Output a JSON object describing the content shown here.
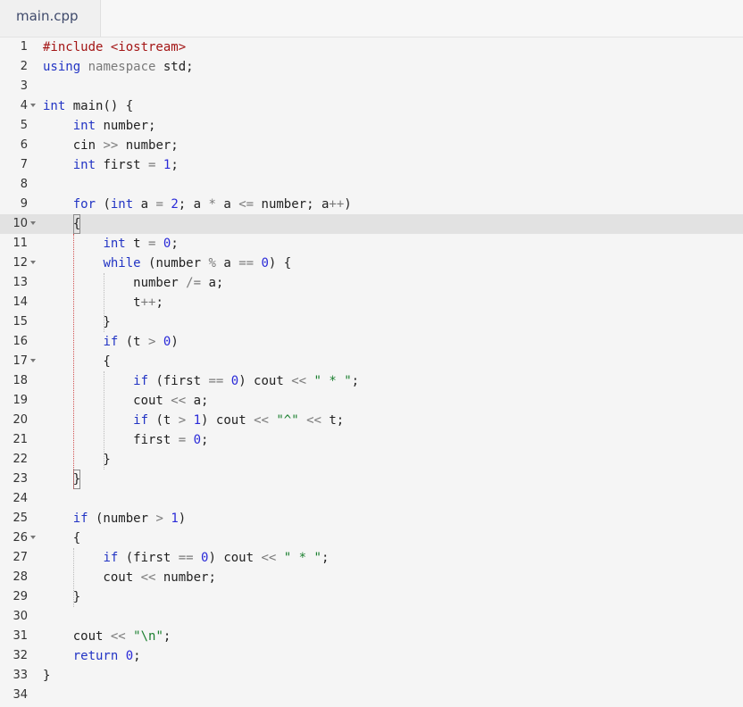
{
  "tab": {
    "label": "main.cpp"
  },
  "editor": {
    "active_line": 10,
    "lines": [
      {
        "n": "1",
        "fold": false,
        "tokens": [
          [
            "kw-str",
            "#include "
          ],
          [
            "str",
            "<iostream>"
          ]
        ]
      },
      {
        "n": "2",
        "fold": false,
        "tokens": [
          [
            "kw",
            "using"
          ],
          [
            "p",
            " "
          ],
          [
            "ns",
            "namespace"
          ],
          [
            "p",
            " std;"
          ]
        ]
      },
      {
        "n": "3",
        "fold": false,
        "tokens": []
      },
      {
        "n": "4",
        "fold": true,
        "tokens": [
          [
            "kw",
            "int"
          ],
          [
            "p",
            " main() {"
          ]
        ]
      },
      {
        "n": "5",
        "fold": false,
        "tokens": [
          [
            "p",
            "    "
          ],
          [
            "kw",
            "int"
          ],
          [
            "p",
            " number;"
          ]
        ]
      },
      {
        "n": "6",
        "fold": false,
        "tokens": [
          [
            "p",
            "    cin "
          ],
          [
            "op",
            ">>"
          ],
          [
            "p",
            " number;"
          ]
        ]
      },
      {
        "n": "7",
        "fold": false,
        "tokens": [
          [
            "p",
            "    "
          ],
          [
            "kw",
            "int"
          ],
          [
            "p",
            " first "
          ],
          [
            "op",
            "="
          ],
          [
            "p",
            " "
          ],
          [
            "num",
            "1"
          ],
          [
            "p",
            ";"
          ]
        ]
      },
      {
        "n": "8",
        "fold": false,
        "tokens": []
      },
      {
        "n": "9",
        "fold": false,
        "tokens": [
          [
            "p",
            "    "
          ],
          [
            "kw",
            "for"
          ],
          [
            "p",
            " ("
          ],
          [
            "kw",
            "int"
          ],
          [
            "p",
            " a "
          ],
          [
            "op",
            "="
          ],
          [
            "p",
            " "
          ],
          [
            "num",
            "2"
          ],
          [
            "p",
            "; a "
          ],
          [
            "op",
            "*"
          ],
          [
            "p",
            " a "
          ],
          [
            "op",
            "<="
          ],
          [
            "p",
            " number; a"
          ],
          [
            "op",
            "++"
          ],
          [
            "p",
            ")"
          ]
        ]
      },
      {
        "n": "10",
        "fold": true,
        "tokens": [
          [
            "p",
            "    "
          ],
          [
            "box",
            "{"
          ]
        ]
      },
      {
        "n": "11",
        "fold": false,
        "tokens": [
          [
            "p",
            "        "
          ],
          [
            "kw",
            "int"
          ],
          [
            "p",
            " t "
          ],
          [
            "op",
            "="
          ],
          [
            "p",
            " "
          ],
          [
            "num",
            "0"
          ],
          [
            "p",
            ";"
          ]
        ]
      },
      {
        "n": "12",
        "fold": true,
        "tokens": [
          [
            "p",
            "        "
          ],
          [
            "kw",
            "while"
          ],
          [
            "p",
            " (number "
          ],
          [
            "op",
            "%"
          ],
          [
            "p",
            " a "
          ],
          [
            "op",
            "=="
          ],
          [
            "p",
            " "
          ],
          [
            "num",
            "0"
          ],
          [
            "p",
            ") {"
          ]
        ]
      },
      {
        "n": "13",
        "fold": false,
        "tokens": [
          [
            "p",
            "            number "
          ],
          [
            "op",
            "/="
          ],
          [
            "p",
            " a;"
          ]
        ]
      },
      {
        "n": "14",
        "fold": false,
        "tokens": [
          [
            "p",
            "            t"
          ],
          [
            "op",
            "++"
          ],
          [
            "p",
            ";"
          ]
        ]
      },
      {
        "n": "15",
        "fold": false,
        "tokens": [
          [
            "p",
            "        }"
          ]
        ]
      },
      {
        "n": "16",
        "fold": false,
        "tokens": [
          [
            "p",
            "        "
          ],
          [
            "kw",
            "if"
          ],
          [
            "p",
            " (t "
          ],
          [
            "op",
            ">"
          ],
          [
            "p",
            " "
          ],
          [
            "num",
            "0"
          ],
          [
            "p",
            ")"
          ]
        ]
      },
      {
        "n": "17",
        "fold": true,
        "tokens": [
          [
            "p",
            "        {"
          ]
        ]
      },
      {
        "n": "18",
        "fold": false,
        "tokens": [
          [
            "p",
            "            "
          ],
          [
            "kw",
            "if"
          ],
          [
            "p",
            " (first "
          ],
          [
            "op",
            "=="
          ],
          [
            "p",
            " "
          ],
          [
            "num",
            "0"
          ],
          [
            "p",
            ") cout "
          ],
          [
            "op",
            "<<"
          ],
          [
            "p",
            " "
          ],
          [
            "strg",
            "\" * \""
          ],
          [
            "p",
            ";"
          ]
        ]
      },
      {
        "n": "19",
        "fold": false,
        "tokens": [
          [
            "p",
            "            cout "
          ],
          [
            "op",
            "<<"
          ],
          [
            "p",
            " a;"
          ]
        ]
      },
      {
        "n": "20",
        "fold": false,
        "tokens": [
          [
            "p",
            "            "
          ],
          [
            "kw",
            "if"
          ],
          [
            "p",
            " (t "
          ],
          [
            "op",
            ">"
          ],
          [
            "p",
            " "
          ],
          [
            "num",
            "1"
          ],
          [
            "p",
            ") cout "
          ],
          [
            "op",
            "<<"
          ],
          [
            "p",
            " "
          ],
          [
            "strg",
            "\"^\""
          ],
          [
            "p",
            " "
          ],
          [
            "op",
            "<<"
          ],
          [
            "p",
            " t;"
          ]
        ]
      },
      {
        "n": "21",
        "fold": false,
        "tokens": [
          [
            "p",
            "            first "
          ],
          [
            "op",
            "="
          ],
          [
            "p",
            " "
          ],
          [
            "num",
            "0"
          ],
          [
            "p",
            ";"
          ]
        ]
      },
      {
        "n": "22",
        "fold": false,
        "tokens": [
          [
            "p",
            "        }"
          ]
        ]
      },
      {
        "n": "23",
        "fold": false,
        "tokens": [
          [
            "p",
            "    "
          ],
          [
            "box",
            "}"
          ]
        ]
      },
      {
        "n": "24",
        "fold": false,
        "tokens": []
      },
      {
        "n": "25",
        "fold": false,
        "tokens": [
          [
            "p",
            "    "
          ],
          [
            "kw",
            "if"
          ],
          [
            "p",
            " (number "
          ],
          [
            "op",
            ">"
          ],
          [
            "p",
            " "
          ],
          [
            "num",
            "1"
          ],
          [
            "p",
            ")"
          ]
        ]
      },
      {
        "n": "26",
        "fold": true,
        "tokens": [
          [
            "p",
            "    {"
          ]
        ]
      },
      {
        "n": "27",
        "fold": false,
        "tokens": [
          [
            "p",
            "        "
          ],
          [
            "kw",
            "if"
          ],
          [
            "p",
            " (first "
          ],
          [
            "op",
            "=="
          ],
          [
            "p",
            " "
          ],
          [
            "num",
            "0"
          ],
          [
            "p",
            ") cout "
          ],
          [
            "op",
            "<<"
          ],
          [
            "p",
            " "
          ],
          [
            "strg",
            "\" * \""
          ],
          [
            "p",
            ";"
          ]
        ]
      },
      {
        "n": "28",
        "fold": false,
        "tokens": [
          [
            "p",
            "        cout "
          ],
          [
            "op",
            "<<"
          ],
          [
            "p",
            " number;"
          ]
        ]
      },
      {
        "n": "29",
        "fold": false,
        "tokens": [
          [
            "p",
            "    }"
          ]
        ]
      },
      {
        "n": "30",
        "fold": false,
        "tokens": []
      },
      {
        "n": "31",
        "fold": false,
        "tokens": [
          [
            "p",
            "    cout "
          ],
          [
            "op",
            "<<"
          ],
          [
            "p",
            " "
          ],
          [
            "strg",
            "\"\\n\""
          ],
          [
            "p",
            ";"
          ]
        ]
      },
      {
        "n": "32",
        "fold": false,
        "tokens": [
          [
            "p",
            "    "
          ],
          [
            "kw",
            "return"
          ],
          [
            "p",
            " "
          ],
          [
            "num",
            "0"
          ],
          [
            "p",
            ";"
          ]
        ]
      },
      {
        "n": "33",
        "fold": false,
        "tokens": [
          [
            "p",
            "}"
          ]
        ]
      },
      {
        "n": "34",
        "fold": false,
        "tokens": []
      }
    ]
  },
  "colors": {
    "keyword": "#2234c4",
    "include_string": "#a31515",
    "string": "#1a7f2e",
    "number": "#2a2ad8",
    "operator": "#7a7a7a",
    "active_line_bg": "#e2e2e2"
  }
}
